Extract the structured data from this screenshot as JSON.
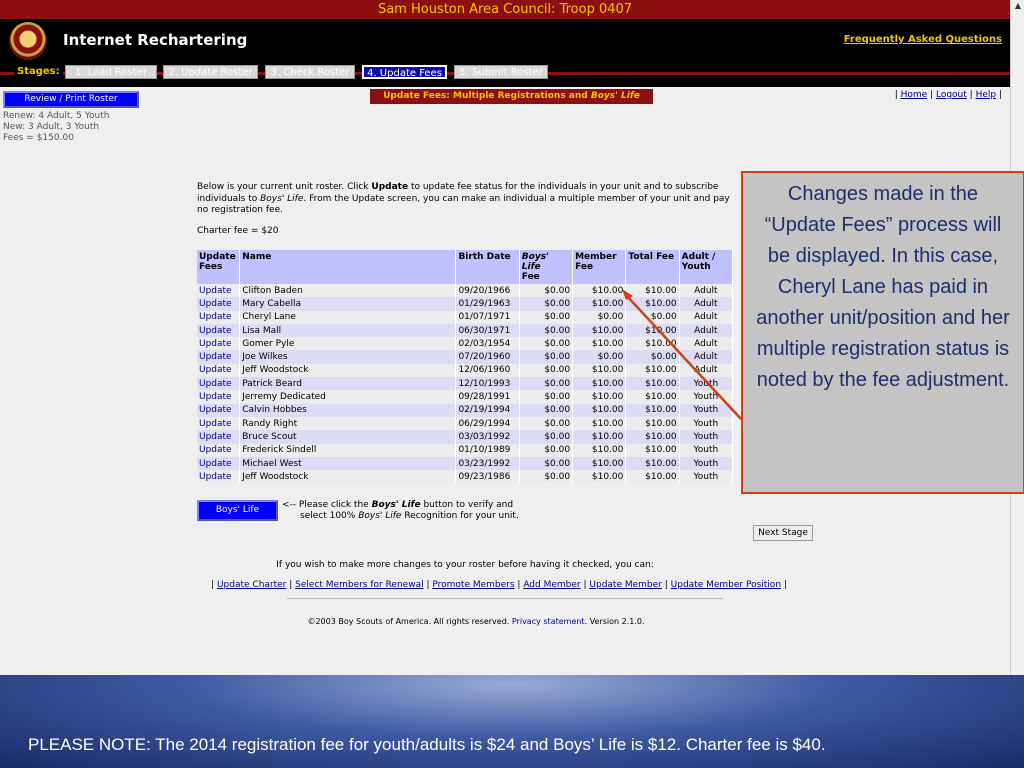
{
  "topbar_title": "Sam Houston Area Council: Troop 0407",
  "app_title": "Internet Rechartering",
  "faq_link": "Frequently Asked Questions",
  "stages_label": "Stages:",
  "stages": [
    {
      "label": "1. Load Roster",
      "state": "inactive"
    },
    {
      "label": "2. Update Roster",
      "state": "inactive"
    },
    {
      "label": "3. Check Roster",
      "state": "inactive"
    },
    {
      "label": "4. Update Fees",
      "state": "active"
    },
    {
      "label": "5. Submit Roster",
      "state": "inactive"
    }
  ],
  "review_button": "Review / Print Roster",
  "status_info": {
    "renew": "Renew: 4 Adult, 5 Youth",
    "new": "New: 3 Adult, 3 Youth",
    "fees": "Fees = $150.00"
  },
  "page_banner": {
    "prefix": "Update Fees: Multiple Registrations and ",
    "italic": "Boys' Life"
  },
  "top_links": [
    "Home",
    "Logout",
    "Help"
  ],
  "intro": {
    "part1": "Below is your current unit roster. Click ",
    "bold": "Update",
    "part2": " to update fee status for the individuals in your unit and to subscribe individuals to ",
    "italic": "Boys' Life",
    "part3": ". From the Update screen, you can make an individual a multiple member of your unit and pay no registration fee."
  },
  "charter_fee": "Charter fee = $20",
  "table": {
    "headers": {
      "update": "Update Fees",
      "name": "Name",
      "birth": "Birth Date",
      "boys_life": "Boys' Life",
      "boys_life_sub": "Fee",
      "member": "Member Fee",
      "total": "Total Fee",
      "type": "Adult / Youth"
    },
    "link_label": "Update",
    "rows": [
      {
        "name": "Clifton Baden",
        "birth": "09/20/1966",
        "bl": "$0.00",
        "member": "$10.00",
        "total": "$10.00",
        "type": "Adult"
      },
      {
        "name": "Mary Cabella",
        "birth": "01/29/1963",
        "bl": "$0.00",
        "member": "$10.00",
        "total": "$10.00",
        "type": "Adult"
      },
      {
        "name": "Cheryl Lane",
        "birth": "01/07/1971",
        "bl": "$0.00",
        "member": "$0.00",
        "total": "$0.00",
        "type": "Adult"
      },
      {
        "name": "Lisa Mall",
        "birth": "06/30/1971",
        "bl": "$0.00",
        "member": "$10.00",
        "total": "$10.00",
        "type": "Adult"
      },
      {
        "name": "Gomer Pyle",
        "birth": "02/03/1954",
        "bl": "$0.00",
        "member": "$10.00",
        "total": "$10.00",
        "type": "Adult"
      },
      {
        "name": "Joe Wilkes",
        "birth": "07/20/1960",
        "bl": "$0.00",
        "member": "$0.00",
        "total": "$0.00",
        "type": "Adult"
      },
      {
        "name": "Jeff Woodstock",
        "birth": "12/06/1960",
        "bl": "$0.00",
        "member": "$10.00",
        "total": "$10.00",
        "type": "Adult"
      },
      {
        "name": "Patrick Beard",
        "birth": "12/10/1993",
        "bl": "$0.00",
        "member": "$10.00",
        "total": "$10.00",
        "type": "Youth"
      },
      {
        "name": "Jerremy Dedicated",
        "birth": "09/28/1991",
        "bl": "$0.00",
        "member": "$10.00",
        "total": "$10.00",
        "type": "Youth"
      },
      {
        "name": "Calvin Hobbes",
        "birth": "02/19/1994",
        "bl": "$0.00",
        "member": "$10.00",
        "total": "$10.00",
        "type": "Youth"
      },
      {
        "name": "Randy Right",
        "birth": "06/29/1994",
        "bl": "$0.00",
        "member": "$10.00",
        "total": "$10.00",
        "type": "Youth"
      },
      {
        "name": "Bruce Scout",
        "birth": "03/03/1992",
        "bl": "$0.00",
        "member": "$10.00",
        "total": "$10.00",
        "type": "Youth"
      },
      {
        "name": "Frederick Sindell",
        "birth": "01/10/1989",
        "bl": "$0.00",
        "member": "$10.00",
        "total": "$10.00",
        "type": "Youth"
      },
      {
        "name": "Michael West",
        "birth": "03/23/1992",
        "bl": "$0.00",
        "member": "$10.00",
        "total": "$10.00",
        "type": "Youth"
      },
      {
        "name": "Jeff Woodstock",
        "birth": "09/23/1986",
        "bl": "$0.00",
        "member": "$10.00",
        "total": "$10.00",
        "type": "Youth"
      }
    ]
  },
  "boys_life_button": "Boys' Life",
  "boys_life_note": {
    "line1_prefix": "<-- Please click the ",
    "line1_bold": "Boys' Life",
    "line1_suffix": " button to verify and",
    "line2_prefix": "select 100% ",
    "line2_italic": "Boys' Life",
    "line2_suffix": " Recognition for your unit."
  },
  "next_stage": "Next Stage",
  "more_changes": "If you wish to make more changes to your roster before having it checked, you can:",
  "bottom_links": [
    "Update Charter",
    "Select Members for Renewal",
    "Promote Members",
    "Add Member",
    "Update Member",
    "Update Member Position"
  ],
  "copyright": {
    "prefix": "©2003 Boy Scouts of America. All rights reserved. ",
    "link": "Privacy statement",
    "suffix": ". Version 2.1.0."
  },
  "callout": "Changes made in the “Update Fees” process will be displayed.  In this case, Cheryl Lane has paid in another unit/position and her multiple registration status is noted by the fee adjustment.",
  "footer_note": "PLEASE NOTE: The 2014 registration fee for youth/adults is $24 and Boys’ Life is $12.  Charter fee is $40.",
  "colors": {
    "accent_red": "#8c1010",
    "gold": "#f5c400",
    "header_blue": "#c0c0ff",
    "callout_border": "#d04010"
  }
}
